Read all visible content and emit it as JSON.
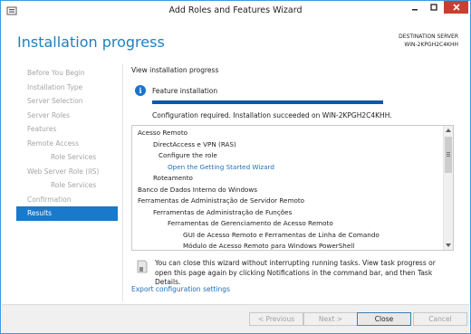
{
  "window": {
    "title": "Add Roles and Features Wizard"
  },
  "header": {
    "page_title": "Installation progress",
    "destination_label": "DESTINATION SERVER",
    "destination_server": "WIN-2KPGH2C4KHH"
  },
  "nav": {
    "items": [
      {
        "label": "Before You Begin",
        "state": "disabled"
      },
      {
        "label": "Installation Type",
        "state": "disabled"
      },
      {
        "label": "Server Selection",
        "state": "disabled"
      },
      {
        "label": "Server Roles",
        "state": "disabled"
      },
      {
        "label": "Features",
        "state": "disabled"
      },
      {
        "label": "Remote Access",
        "state": "disabled"
      },
      {
        "label": "Role Services",
        "state": "disabled",
        "sub": true
      },
      {
        "label": "Web Server Role (IIS)",
        "state": "disabled"
      },
      {
        "label": "Role Services",
        "state": "disabled",
        "sub": true
      },
      {
        "label": "Confirmation",
        "state": "disabled"
      },
      {
        "label": "Results",
        "state": "active"
      }
    ]
  },
  "main": {
    "heading": "View installation progress",
    "info_label": "Feature installation",
    "progress": 1.0,
    "status": "Configuration required. Installation succeeded on WIN-2KPGH2C4KHH.",
    "results": [
      {
        "text": "Acesso Remoto",
        "indent": 0,
        "style": "normal"
      },
      {
        "text": "DirectAccess e VPN (RAS)",
        "indent": 1,
        "style": "normal"
      },
      {
        "text": "Configure the role",
        "indent": 2,
        "style": "normal"
      },
      {
        "text": "Open the Getting Started Wizard",
        "indent": 3,
        "style": "link"
      },
      {
        "text": "Roteamento",
        "indent": 1,
        "style": "normal"
      },
      {
        "text": "Banco de Dados Interno do Windows",
        "indent": 0,
        "style": "normal"
      },
      {
        "text": "Ferramentas de Administração de Servidor Remoto",
        "indent": 0,
        "style": "normal"
      },
      {
        "text": "Ferramentas de Administração de Funções",
        "indent": 1,
        "style": "normal"
      },
      {
        "text": "Ferramentas de Gerenciamento de Acesso Remoto",
        "indent": 2,
        "style": "normal"
      },
      {
        "text": "GUI de Acesso Remoto e Ferramentas de Linha de Comando",
        "indent": 3,
        "style": "normal"
      },
      {
        "text": "Módulo de Acesso Remoto para Windows PowerShell",
        "indent": 3,
        "style": "normal"
      }
    ],
    "note": "You can close this wizard without interrupting running tasks. View task progress or open this page again by clicking Notifications in the command bar, and then Task Details.",
    "export_link": "Export configuration settings"
  },
  "footer": {
    "previous_label": "< Previous",
    "next_label": "Next >",
    "close_label": "Close",
    "cancel_label": "Cancel"
  },
  "colors": {
    "accent": "#1e7fbe",
    "nav_active": "#1979ca",
    "progress": "#0b5aa7",
    "link": "#1e6fbf",
    "close_button": "#c7402f"
  }
}
